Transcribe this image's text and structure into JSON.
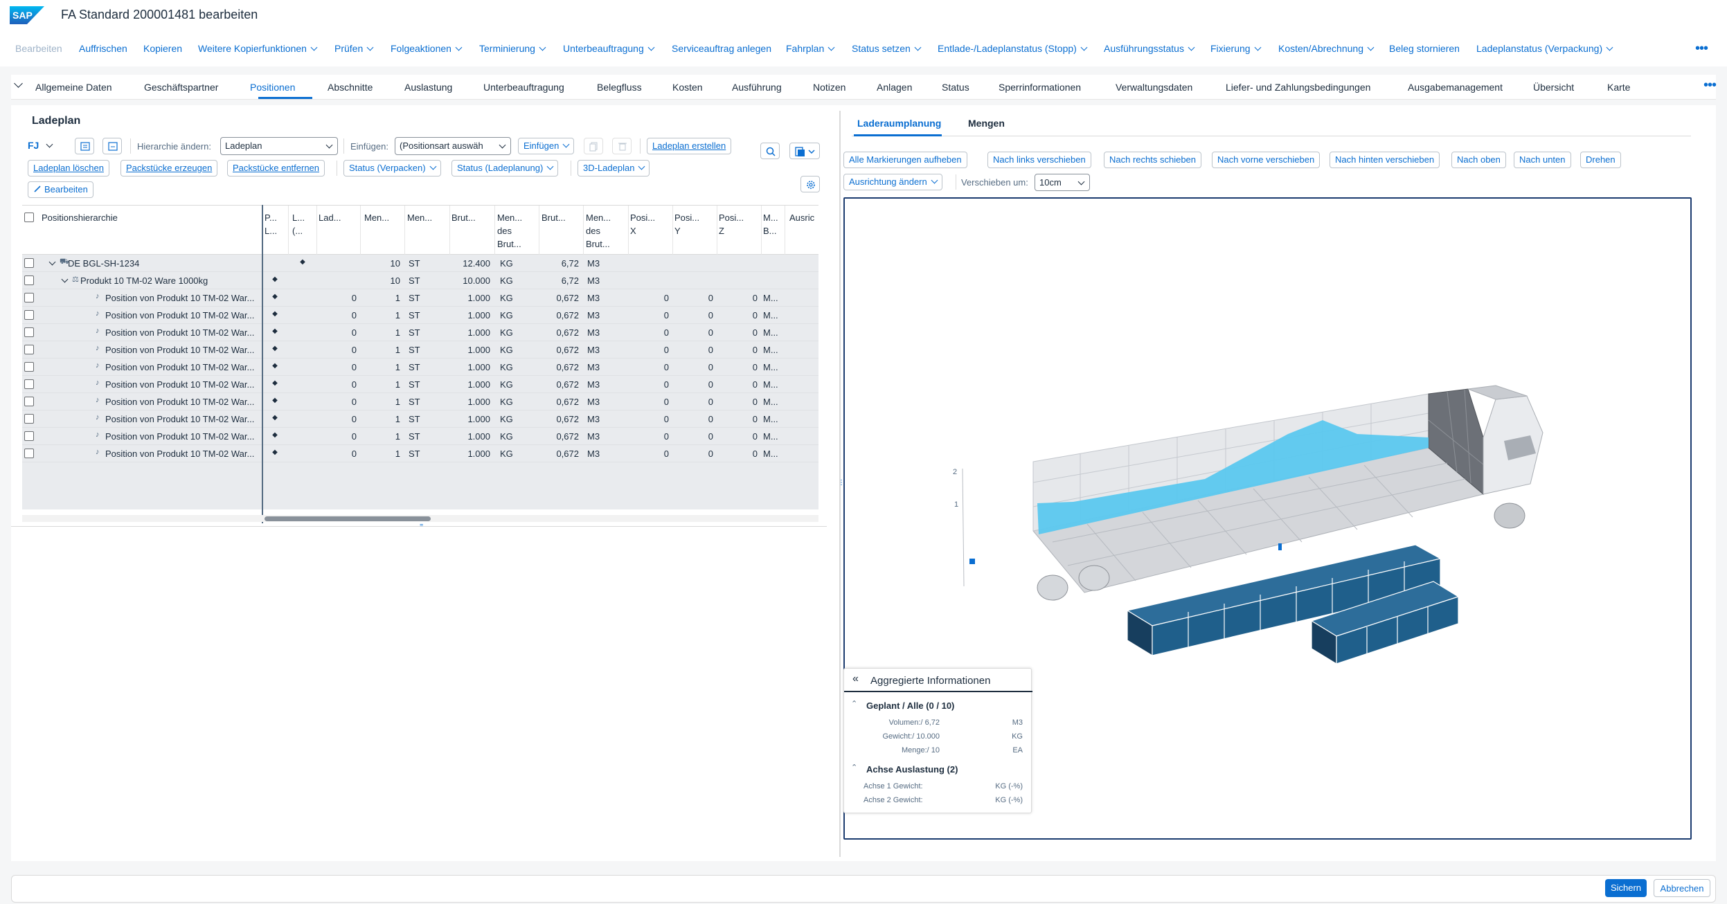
{
  "app": {
    "logo": "SAP",
    "title": "FA Standard 200001481 bearbeiten"
  },
  "actions": [
    {
      "label": "Bearbeiten",
      "disabled": true,
      "caret": false
    },
    {
      "label": "Auffrischen",
      "caret": false
    },
    {
      "label": "Kopieren",
      "caret": false
    },
    {
      "label": "Weitere Kopierfunktionen",
      "caret": true
    },
    {
      "label": "Prüfen",
      "caret": true
    },
    {
      "label": "Folgeaktionen",
      "caret": true
    },
    {
      "label": "Terminierung",
      "caret": true
    },
    {
      "label": "Unterbeauftragung",
      "caret": true
    },
    {
      "label": "Serviceauftrag anlegen",
      "caret": false
    },
    {
      "label": "Fahrplan",
      "caret": true
    },
    {
      "label": "Status setzen",
      "caret": true
    },
    {
      "label": "Entlade-/Ladeplanstatus (Stopp)",
      "caret": true
    },
    {
      "label": "Ausführungsstatus",
      "caret": true
    },
    {
      "label": "Fixierung",
      "caret": true
    },
    {
      "label": "Kosten/Abrechnung",
      "caret": true
    },
    {
      "label": "Beleg stornieren",
      "caret": false
    },
    {
      "label": "Ladeplanstatus (Verpackung)",
      "caret": true
    }
  ],
  "tabs": [
    "Allgemeine Daten",
    "Geschäftspartner",
    "Positionen",
    "Abschnitte",
    "Auslastung",
    "Unterbeauftragung",
    "Belegfluss",
    "Kosten",
    "Ausführung",
    "Notizen",
    "Anlagen",
    "Status",
    "Sperrinformationen",
    "Verwaltungsdaten",
    "Liefer- und Zahlungsbedingungen",
    "Ausgabemanagement",
    "Übersicht",
    "Karte"
  ],
  "active_tab": "Positionen",
  "ladeplan": {
    "title": "Ladeplan",
    "variant": "FJ",
    "hierarchy_label": "Hierarchie ändern:",
    "hierarchy_value": "Ladeplan",
    "insert_label": "Einfügen:",
    "insert_placeholder": "(Positionsart auswäh",
    "insert_button": "Einfügen",
    "create_button": "Ladeplan erstellen",
    "delete_button": "Ladeplan löschen",
    "create_packages": "Packstücke erzeugen",
    "remove_packages": "Packstücke entfernen",
    "status_pack": "Status (Verpacken)",
    "status_plan": "Status (Ladeplanung)",
    "plan3d": "3D-Ladeplan",
    "edit_button": "Bearbeiten"
  },
  "table": {
    "headers": [
      [
        "Positionshierarchie"
      ],
      [
        "P...",
        "L..."
      ],
      [
        "L...",
        "(..."
      ],
      [
        "Lad..."
      ],
      [
        "Men..."
      ],
      [
        "Men..."
      ],
      [
        "Brut..."
      ],
      [
        "Men...",
        "des",
        "Brut..."
      ],
      [
        "Brut..."
      ],
      [
        "Men...",
        "des",
        "Brut..."
      ],
      [
        "Posi...",
        "X"
      ],
      [
        "Posi...",
        "Y"
      ],
      [
        "Posi...",
        "Z"
      ],
      [
        "M...",
        "B..."
      ],
      [
        "Ausric"
      ]
    ],
    "rows": [
      {
        "indent": 0,
        "expand": true,
        "icon": "truck-icon",
        "name": "DE BGL-SH-1234",
        "p": "",
        "l": "◆",
        "lad": "",
        "men": "10",
        "unit": "ST",
        "brut": "12.400",
        "bunit": "KG",
        "vol": "6,72",
        "vunit": "M3",
        "x": "",
        "y": "",
        "z": "",
        "mb": ""
      },
      {
        "indent": 1,
        "expand": true,
        "icon": "product-icon",
        "name": "Produkt 10 TM-02 Ware 1000kg",
        "p": "◆",
        "l": "",
        "lad": "",
        "men": "10",
        "unit": "ST",
        "brut": "10.000",
        "bunit": "KG",
        "vol": "6,72",
        "vunit": "M3",
        "x": "",
        "y": "",
        "z": "",
        "mb": ""
      },
      {
        "indent": 2,
        "expand": false,
        "icon": "position-icon",
        "name": "Position von Produkt 10 TM-02 War...",
        "p": "◆",
        "l": "",
        "lad": "0",
        "men": "1",
        "unit": "ST",
        "brut": "1.000",
        "bunit": "KG",
        "vol": "0,672",
        "vunit": "M3",
        "x": "0",
        "y": "0",
        "z": "0",
        "mb": "M..."
      },
      {
        "indent": 2,
        "expand": false,
        "icon": "position-icon",
        "name": "Position von Produkt 10 TM-02 War...",
        "p": "◆",
        "l": "",
        "lad": "0",
        "men": "1",
        "unit": "ST",
        "brut": "1.000",
        "bunit": "KG",
        "vol": "0,672",
        "vunit": "M3",
        "x": "0",
        "y": "0",
        "z": "0",
        "mb": "M..."
      },
      {
        "indent": 2,
        "expand": false,
        "icon": "position-icon",
        "name": "Position von Produkt 10 TM-02 War...",
        "p": "◆",
        "l": "",
        "lad": "0",
        "men": "1",
        "unit": "ST",
        "brut": "1.000",
        "bunit": "KG",
        "vol": "0,672",
        "vunit": "M3",
        "x": "0",
        "y": "0",
        "z": "0",
        "mb": "M..."
      },
      {
        "indent": 2,
        "expand": false,
        "icon": "position-icon",
        "name": "Position von Produkt 10 TM-02 War...",
        "p": "◆",
        "l": "",
        "lad": "0",
        "men": "1",
        "unit": "ST",
        "brut": "1.000",
        "bunit": "KG",
        "vol": "0,672",
        "vunit": "M3",
        "x": "0",
        "y": "0",
        "z": "0",
        "mb": "M..."
      },
      {
        "indent": 2,
        "expand": false,
        "icon": "position-icon",
        "name": "Position von Produkt 10 TM-02 War...",
        "p": "◆",
        "l": "",
        "lad": "0",
        "men": "1",
        "unit": "ST",
        "brut": "1.000",
        "bunit": "KG",
        "vol": "0,672",
        "vunit": "M3",
        "x": "0",
        "y": "0",
        "z": "0",
        "mb": "M..."
      },
      {
        "indent": 2,
        "expand": false,
        "icon": "position-icon",
        "name": "Position von Produkt 10 TM-02 War...",
        "p": "◆",
        "l": "",
        "lad": "0",
        "men": "1",
        "unit": "ST",
        "brut": "1.000",
        "bunit": "KG",
        "vol": "0,672",
        "vunit": "M3",
        "x": "0",
        "y": "0",
        "z": "0",
        "mb": "M..."
      },
      {
        "indent": 2,
        "expand": false,
        "icon": "position-icon",
        "name": "Position von Produkt 10 TM-02 War...",
        "p": "◆",
        "l": "",
        "lad": "0",
        "men": "1",
        "unit": "ST",
        "brut": "1.000",
        "bunit": "KG",
        "vol": "0,672",
        "vunit": "M3",
        "x": "0",
        "y": "0",
        "z": "0",
        "mb": "M..."
      },
      {
        "indent": 2,
        "expand": false,
        "icon": "position-icon",
        "name": "Position von Produkt 10 TM-02 War...",
        "p": "◆",
        "l": "",
        "lad": "0",
        "men": "1",
        "unit": "ST",
        "brut": "1.000",
        "bunit": "KG",
        "vol": "0,672",
        "vunit": "M3",
        "x": "0",
        "y": "0",
        "z": "0",
        "mb": "M..."
      },
      {
        "indent": 2,
        "expand": false,
        "icon": "position-icon",
        "name": "Position von Produkt 10 TM-02 War...",
        "p": "◆",
        "l": "",
        "lad": "0",
        "men": "1",
        "unit": "ST",
        "brut": "1.000",
        "bunit": "KG",
        "vol": "0,672",
        "vunit": "M3",
        "x": "0",
        "y": "0",
        "z": "0",
        "mb": "M..."
      },
      {
        "indent": 2,
        "expand": false,
        "icon": "position-icon",
        "name": "Position von Produkt 10 TM-02 War...",
        "p": "◆",
        "l": "",
        "lad": "0",
        "men": "1",
        "unit": "ST",
        "brut": "1.000",
        "bunit": "KG",
        "vol": "0,672",
        "vunit": "M3",
        "x": "0",
        "y": "0",
        "z": "0",
        "mb": "M..."
      }
    ]
  },
  "right": {
    "tabs": [
      "Laderaumplanung",
      "Mengen"
    ],
    "active_tab": "Laderaumplanung",
    "buttons": [
      "Alle Markierungen aufheben",
      "Nach links verschieben",
      "Nach rechts schieben",
      "Nach vorne verschieben",
      "Nach hinten verschieben",
      "Nach oben",
      "Nach unten",
      "Drehen"
    ],
    "orientation_button": "Ausrichtung ändern",
    "move_label": "Verschieben um:",
    "move_value": "10cm",
    "axis_ticks": [
      "2",
      "1"
    ]
  },
  "aggregate": {
    "title": "Aggregierte Informationen",
    "planned_header": "Geplant / Alle (0 / 10)",
    "planned": [
      {
        "label": "Volumen:/ 6,72",
        "unit": "M3"
      },
      {
        "label": "Gewicht:/ 10.000",
        "unit": "KG"
      },
      {
        "label": "Menge:/ 10",
        "unit": "EA"
      }
    ],
    "axle_header": "Achse Auslastung (2)",
    "axle": [
      {
        "label": "Achse 1 Gewicht:",
        "unit": "KG (-%)"
      },
      {
        "label": "Achse 2 Gewicht:",
        "unit": "KG (-%)"
      }
    ]
  },
  "footer": {
    "save": "Sichern",
    "cancel": "Abbrechen"
  },
  "colors": {
    "accent": "#0a6ed1",
    "cargo": "#5bc8ef",
    "boxes": "#1f5f8b",
    "frame": "#1b3b6f"
  }
}
